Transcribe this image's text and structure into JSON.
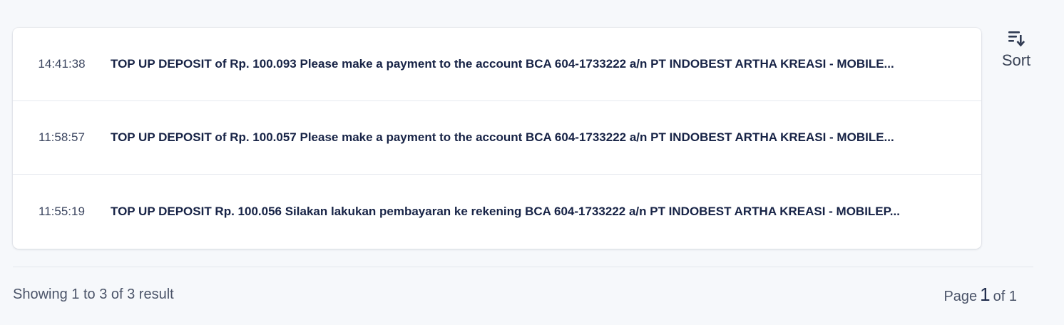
{
  "notifications": [
    {
      "time": "14:41:38",
      "message": "TOP UP DEPOSIT of Rp. 100.093 Please make a payment to the account BCA 604-1733222 a/n PT INDOBEST ARTHA KREASI - MOBILE..."
    },
    {
      "time": "11:58:57",
      "message": "TOP UP DEPOSIT of Rp. 100.057 Please make a payment to the account BCA 604-1733222 a/n PT INDOBEST ARTHA KREASI - MOBILE..."
    },
    {
      "time": "11:55:19",
      "message": "TOP UP DEPOSIT Rp. 100.056 Silakan lakukan pembayaran ke rekening BCA 604-1733222 a/n PT INDOBEST ARTHA KREASI - MOBILEP..."
    }
  ],
  "sort": {
    "label": "Sort",
    "icon": "sort-icon"
  },
  "footer": {
    "showing": "Showing 1 to 3 of 3 result",
    "page_label": "Page",
    "page_current": "1",
    "page_of": "of 1"
  }
}
